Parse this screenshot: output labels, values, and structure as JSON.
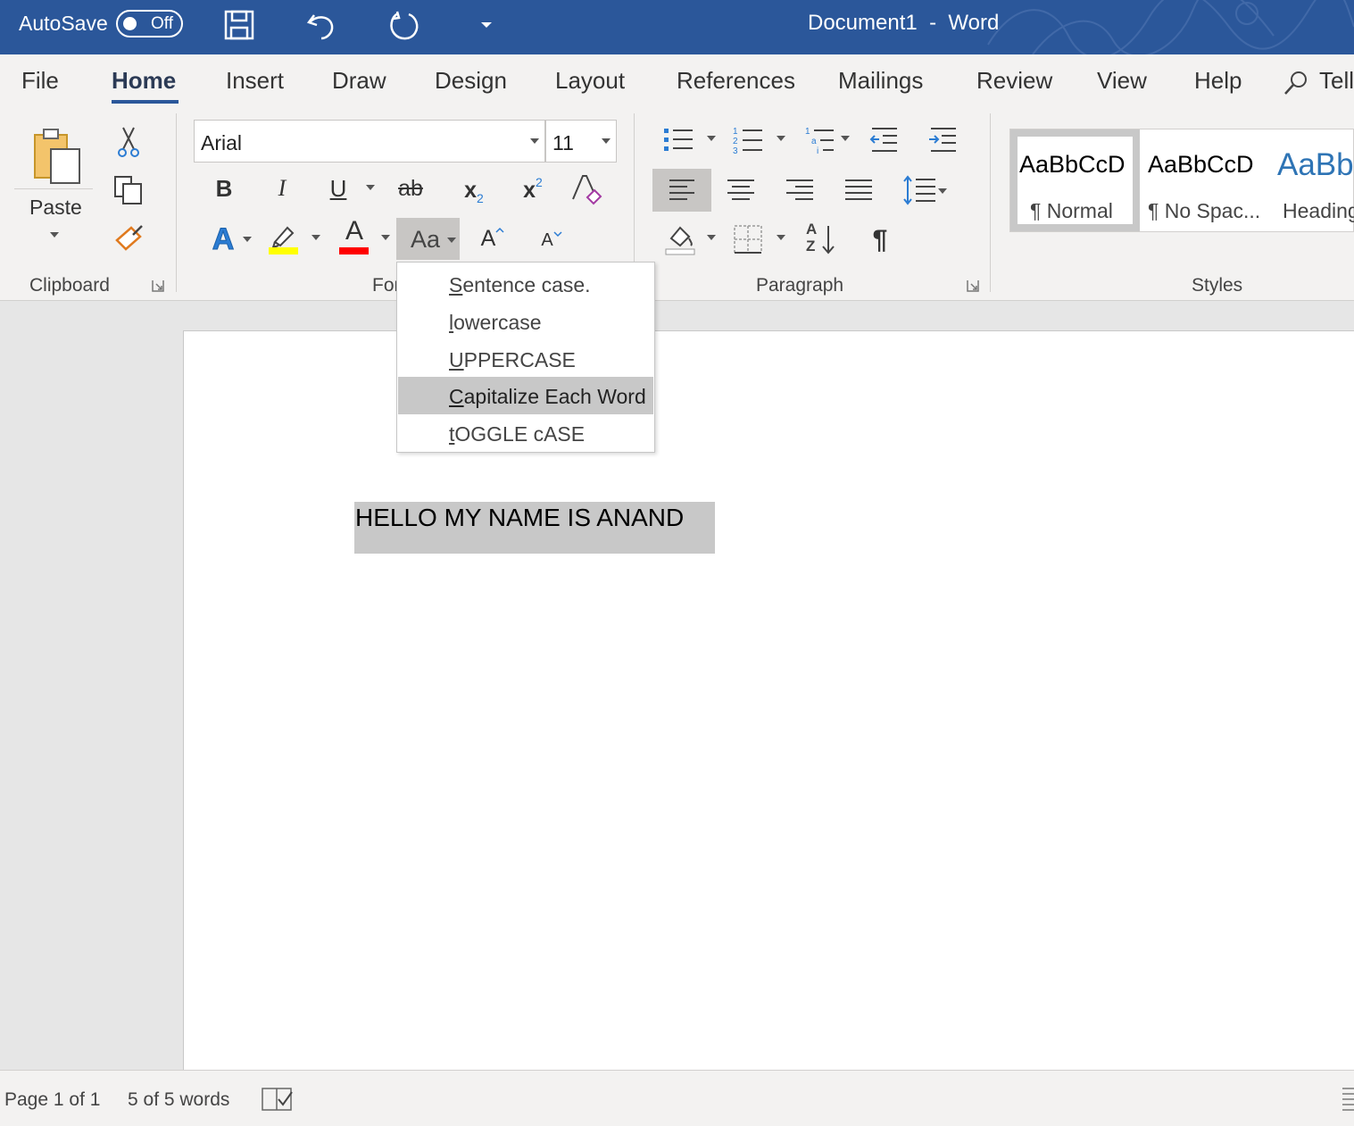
{
  "titlebar": {
    "autosave_label": "AutoSave",
    "autosave_state": "Off",
    "document_title": "Document1  -  Word",
    "accent_color": "#2b579a"
  },
  "tabs": [
    {
      "label": "File"
    },
    {
      "label": "Home",
      "active": true
    },
    {
      "label": "Insert"
    },
    {
      "label": "Draw"
    },
    {
      "label": "Design"
    },
    {
      "label": "Layout"
    },
    {
      "label": "References"
    },
    {
      "label": "Mailings"
    },
    {
      "label": "Review"
    },
    {
      "label": "View"
    },
    {
      "label": "Help"
    },
    {
      "label": "Tell"
    }
  ],
  "ribbon": {
    "clipboard": {
      "label": "Clipboard",
      "paste_label": "Paste"
    },
    "font": {
      "label": "Fon",
      "font_name": "Arial",
      "font_size": "11",
      "bold": "B",
      "italic": "I",
      "underline": "U",
      "strike": "ab",
      "subscript": "x",
      "subscript_small": "2",
      "superscript": "x",
      "superscript_small": "2",
      "change_case": "Aa",
      "grow_font": "A",
      "shrink_font": "A",
      "text_effects": "A",
      "font_color": "A",
      "highlight_color": "#ffff00",
      "font_color_value": "#ff0000"
    },
    "paragraph": {
      "label": "Paragraph",
      "sort_top": "A",
      "sort_bottom": "Z",
      "pilcrow": "¶"
    },
    "styles": {
      "label": "Styles",
      "items": [
        {
          "sample": "AaBbCcD",
          "name": "¶ Normal",
          "selected": true
        },
        {
          "sample": "AaBbCcD",
          "name": "¶ No Spac..."
        },
        {
          "sample": "AaBb",
          "name": "Heading"
        }
      ]
    }
  },
  "change_case_menu": {
    "items": [
      {
        "label": "Sentence case.",
        "key": "S"
      },
      {
        "label": "lowercase",
        "key": "l"
      },
      {
        "label": "UPPERCASE",
        "key": "U"
      },
      {
        "label": "Capitalize Each Word",
        "key": "C",
        "hover": true
      },
      {
        "label": "tOGGLE cASE",
        "key": "t"
      }
    ]
  },
  "document": {
    "text": "HELLO MY NAME IS ANAND"
  },
  "statusbar": {
    "page": "Page 1 of 1",
    "words": "5 of 5 words"
  }
}
